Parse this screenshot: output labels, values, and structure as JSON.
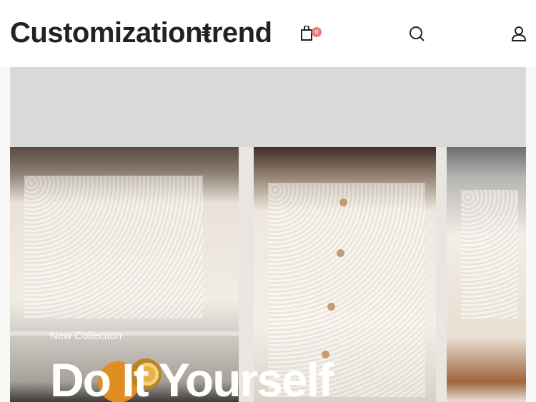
{
  "header": {
    "logo_text": "Customizationtrend",
    "cart_count": "0",
    "icons": [
      "menu-icon",
      "shopping-bag-icon",
      "search-icon",
      "user-icon"
    ]
  },
  "hero": {
    "subtitle": "New Collection",
    "title": "Do It Yourself"
  },
  "colors": {
    "badge": "#e77f80",
    "text_dark": "#222222",
    "hero_text": "#ffffff",
    "hero_bg": "#d9d9d9"
  }
}
